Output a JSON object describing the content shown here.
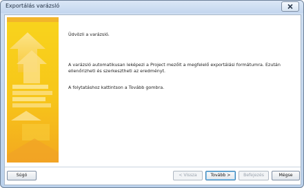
{
  "window": {
    "title": "Exportálás varázsló"
  },
  "content": {
    "greeting": "Üdvözli a varázsló.",
    "description": "A varázsló automatikusan leképezi a Project mezőit a megfelelő exportálási formátumra. Ezután ellenőrizheti és szerkesztheti az eredményt.",
    "instruction": "A folytatáshoz kattintson a Tovább gombra."
  },
  "buttons": {
    "help": "Súgó",
    "back": "< Vissza",
    "next": "Tovább >",
    "finish": "Befejezés",
    "cancel": "Mégse"
  },
  "colors": {
    "banner_yellow": "#f6d21a",
    "banner_orange": "#f2a623",
    "title_bar": "#c9dbf0"
  },
  "icons": [
    "close-icon",
    "wizard-banner-graphic"
  ]
}
